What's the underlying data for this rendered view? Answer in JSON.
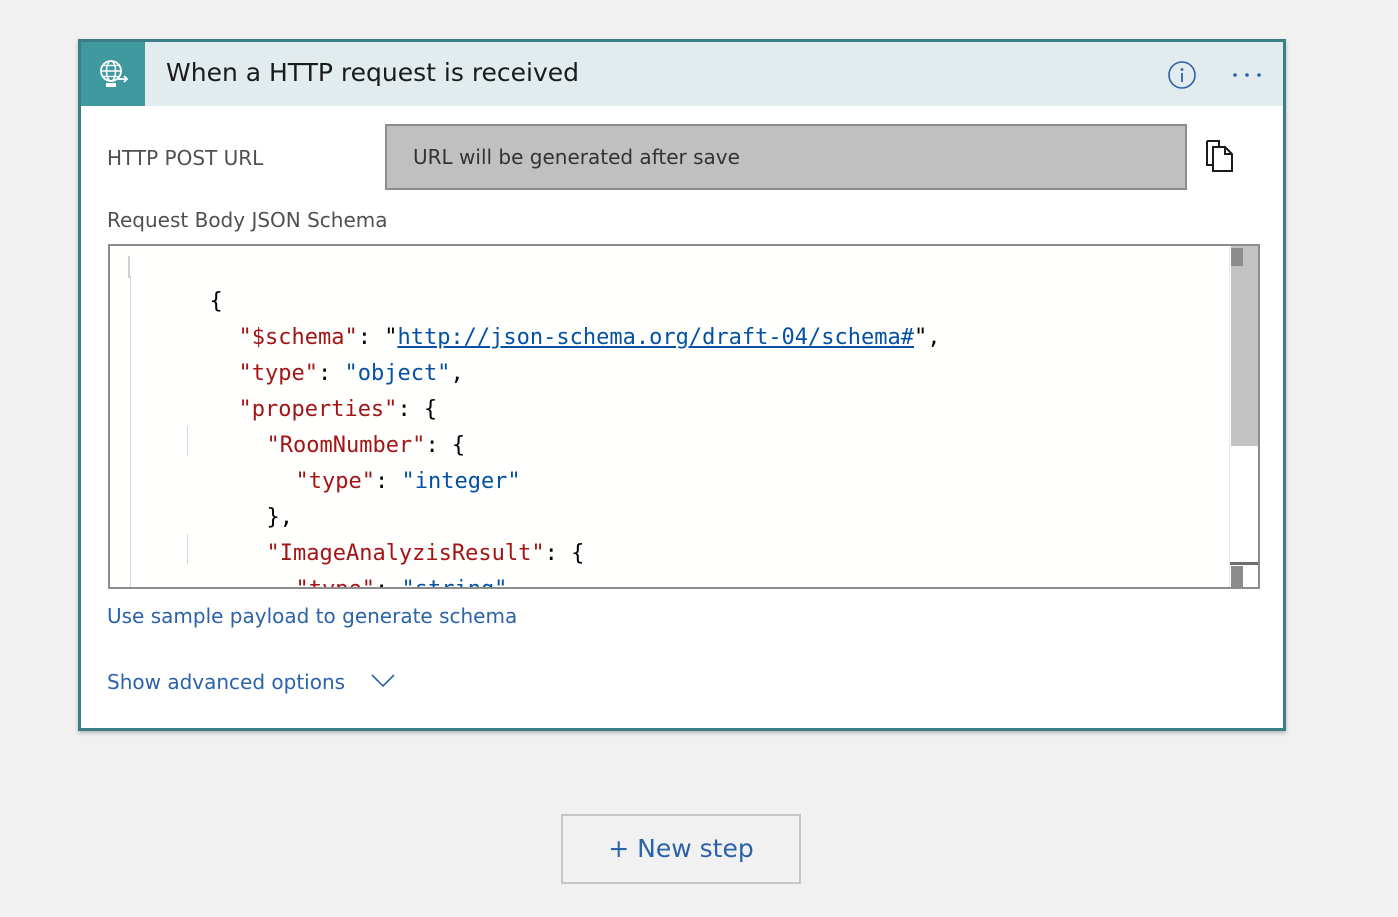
{
  "trigger": {
    "icon": "globe-request-icon",
    "title": "When a HTTP request is received",
    "info_icon": "info-icon",
    "more_icon": "more-options-icon"
  },
  "http_post_url": {
    "label": "HTTP POST URL",
    "value": "URL will be generated after save",
    "copy_icon": "copy-icon"
  },
  "schema": {
    "label": "Request Body JSON Schema",
    "lines": [
      [
        "{"
      ],
      [
        "\"$schema\"",
        ": \"",
        "http://json-schema.org/draft-04/schema#",
        "\","
      ],
      [
        "\"type\"",
        ": ",
        "\"object\"",
        ","
      ],
      [
        "\"properties\"",
        ": {"
      ],
      [
        "\"RoomNumber\"",
        ": {"
      ],
      [
        "\"type\"",
        ": ",
        "\"integer\""
      ],
      [
        "},"
      ],
      [
        "\"ImageAnalyzisResult\"",
        ": {"
      ],
      [
        "\"type\"",
        ": ",
        "\"string\""
      ],
      [
        "}"
      ]
    ]
  },
  "links": {
    "sample_payload": "Use sample payload to generate schema",
    "advanced": "Show advanced options",
    "advanced_icon": "chevron-down-icon"
  },
  "new_step": {
    "label": "+ New step"
  },
  "colors": {
    "accent": "#3f999e",
    "border": "#3a7e88",
    "header_bg": "#e2ebee",
    "link": "#2c62a8",
    "json_key": "#a31515",
    "json_string": "#0451a5"
  }
}
